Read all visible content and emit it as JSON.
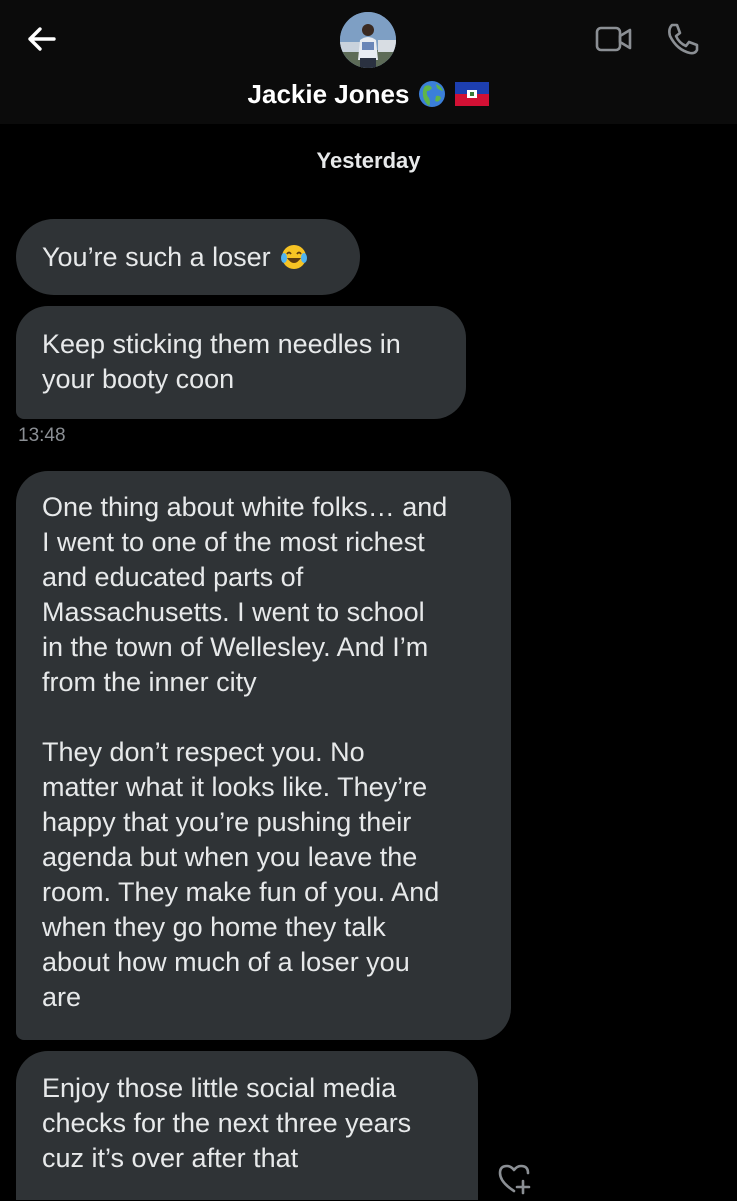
{
  "header": {
    "contact_name": "Jackie Jones",
    "name_emojis": [
      "globe-americas",
      "haiti-flag"
    ],
    "icons": {
      "back": "arrow-left-icon",
      "video": "video-call-icon",
      "phone": "phone-call-icon"
    }
  },
  "conversation": {
    "date_separator": "Yesterday",
    "messages": [
      {
        "lines": [
          "You’re such a loser"
        ],
        "emoji": "face-with-tears-of-joy"
      },
      {
        "lines": [
          "Keep sticking them needles in",
          "your booty coon"
        ]
      },
      {
        "lines": [
          "One thing about white folks… and",
          "I went to one of the most richest",
          "and educated parts of",
          "Massachusetts. I went to school",
          "in the town of Wellesley. And I’m",
          "from the inner city",
          "",
          "They don’t respect you. No",
          "matter what it looks like. They’re",
          "happy that you’re pushing their",
          "agenda but when you leave the",
          "room. They make fun of you. And",
          "when they go home they talk",
          "about how much of a loser you",
          "are"
        ]
      },
      {
        "lines": [
          "Enjoy those little social media",
          "checks for the next three years",
          "cuz it’s over after that"
        ]
      }
    ],
    "timestamp": "13:48"
  },
  "colors": {
    "background": "#000000",
    "header": "#0b0b0b",
    "bubble": "#2f3336",
    "text": "#e7e9ea",
    "muted": "#8b8f94"
  }
}
